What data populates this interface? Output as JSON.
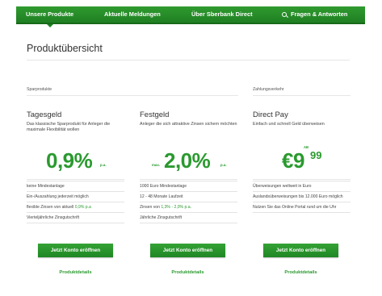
{
  "nav": {
    "items": [
      {
        "label": "Unsere Produkte",
        "active": true
      },
      {
        "label": "Aktuelle Meldungen"
      },
      {
        "label": "Über Sberbank Direct"
      },
      {
        "label": "Fragen & Antworten",
        "icon": "search-icon"
      }
    ]
  },
  "page_title": "Produktübersicht",
  "sections": {
    "savings_label": "Sparprodukte",
    "payments_label": "Zahlungsverkehr"
  },
  "products": [
    {
      "title": "Tagesgeld",
      "description": "Das klassische Sparprodukt für Anleger die maximale Flexibilität wollen",
      "rate": {
        "main": "0,9%",
        "suffix": "p.a."
      },
      "features": [
        {
          "text": "keine Mindestanlage"
        },
        {
          "text": "Ein-/Auszahlung jederzeit möglich"
        },
        {
          "text": "flexible Zinsen von aktuell ",
          "highlight": "0,9% p.a"
        },
        {
          "text": "Vierteljährliche Zinsgutschrift"
        }
      ],
      "cta": "Jetzt Konto eröffnen",
      "details": "Produktdetails"
    },
    {
      "title": "Festgeld",
      "description": "Anleger die sich attraktive Zinsen sichern möchten",
      "rate": {
        "prefix": "max.",
        "main": "2,0%",
        "suffix": "p.a."
      },
      "features": [
        {
          "text": "1000 Euro Mindestanlage"
        },
        {
          "text": "12 - 48 Monate Laufzeit"
        },
        {
          "text": "Zinsen von ",
          "highlight": "1,3% - 2,0% p.a."
        },
        {
          "text": "Jährliche Zinsgutschrift"
        }
      ],
      "cta": "Jetzt Konto eröffnen",
      "details": "Produktdetails"
    },
    {
      "title": "Direct Pay",
      "description": "Einfach und schnell Geld überweisen",
      "rate": {
        "prefix": "AB",
        "main": "€9",
        "sup": "99"
      },
      "features": [
        {
          "text": "Überweisungen weltweit in Euro"
        },
        {
          "text": "Auslandsüberweisungen bis 12.000 Euro möglich"
        },
        {
          "text": "Nutzen Sie das Online Portal rund um die Uhr"
        }
      ],
      "cta": "Jetzt Konto eröffnen",
      "details": "Produktdetails"
    }
  ]
}
